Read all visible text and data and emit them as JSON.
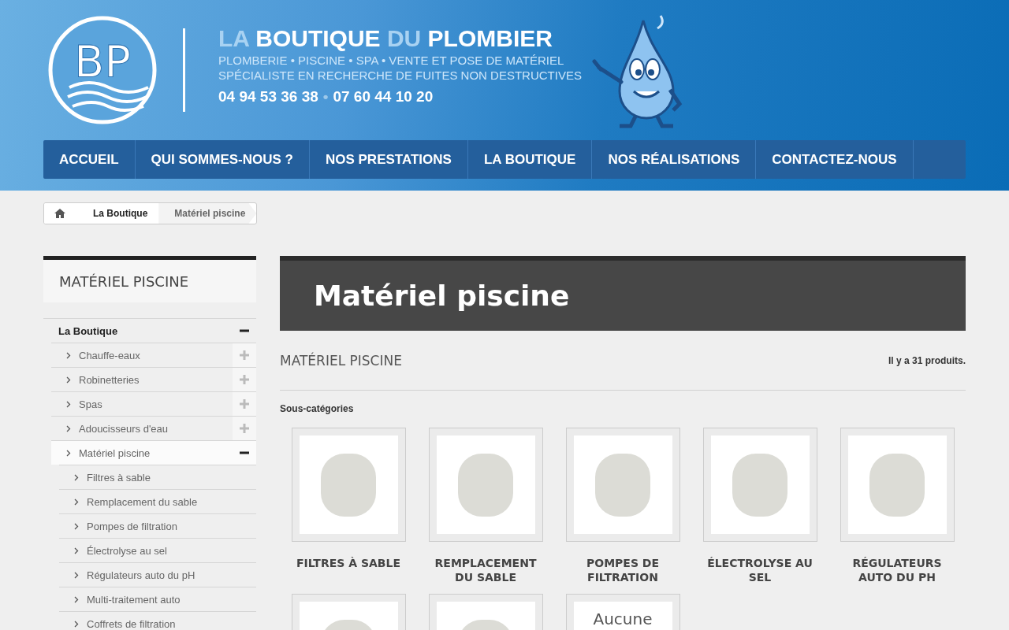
{
  "header": {
    "logo_text": "BP",
    "title": [
      {
        "text": "LA",
        "accent": true
      },
      {
        "text": "BOUTIQUE",
        "accent": false
      },
      {
        "text": "DU",
        "accent": true
      },
      {
        "text": "PLOMBIER",
        "accent": false
      }
    ],
    "taglines": [
      "PLOMBERIE • PISCINE • SPA • VENTE ET POSE DE MATÉRIEL",
      "SPÉCIALISTE EN RECHERCHE DE FUITES NON DESTRUCTIVES"
    ],
    "phones": [
      "04 94 53 36 38",
      "07 60 44 10 20"
    ],
    "phone_separator": "•"
  },
  "nav": [
    "ACCUEIL",
    "QUI SOMMES-NOUS ?",
    "NOS PRESTATIONS",
    "LA BOUTIQUE",
    "NOS RÉALISATIONS",
    "CONTACTEZ-NOUS"
  ],
  "breadcrumb": [
    "La Boutique",
    "Matériel piscine"
  ],
  "sidebar": {
    "title": "MATÉRIEL PISCINE",
    "tree": [
      {
        "label": "La Boutique",
        "selected": false,
        "expanded": true,
        "children": [
          {
            "label": "Chauffe-eaux",
            "selected": false,
            "expanded": false
          },
          {
            "label": "Robinetteries",
            "selected": false,
            "expanded": false
          },
          {
            "label": "Spas",
            "selected": false,
            "expanded": false
          },
          {
            "label": "Adoucisseurs d'eau",
            "selected": false,
            "expanded": false
          },
          {
            "label": "Matériel piscine",
            "selected": true,
            "expanded": true,
            "children": [
              {
                "label": "Filtres à sable",
                "selected": false
              },
              {
                "label": "Remplacement du sable",
                "selected": false
              },
              {
                "label": "Pompes de filtration",
                "selected": false
              },
              {
                "label": "Électrolyse au sel",
                "selected": false
              },
              {
                "label": "Régulateurs auto du pH",
                "selected": false
              },
              {
                "label": "Multi-traitement auto",
                "selected": false
              },
              {
                "label": "Coffrets de filtration",
                "selected": false
              }
            ]
          }
        ]
      }
    ]
  },
  "main": {
    "banner_title": "Matériel piscine",
    "heading": "MATÉRIEL PISCINE",
    "count": "Il y a 31 produits.",
    "subcategories_label": "Sous-catégories",
    "subcategories": [
      {
        "name": "FILTRES À SABLE",
        "kind": "photo"
      },
      {
        "name": "REMPLACEMENT DU SABLE",
        "kind": "photo"
      },
      {
        "name": "POMPES DE FILTRATION",
        "kind": "photo"
      },
      {
        "name": "ÉLECTROLYSE AU SEL",
        "kind": "photo"
      },
      {
        "name": "RÉGULATEURS AUTO DU PH",
        "kind": "photo"
      },
      {
        "kind": "photo"
      },
      {
        "kind": "photo"
      },
      {
        "kind": "no-image",
        "image_text": "Aucune"
      }
    ]
  }
}
